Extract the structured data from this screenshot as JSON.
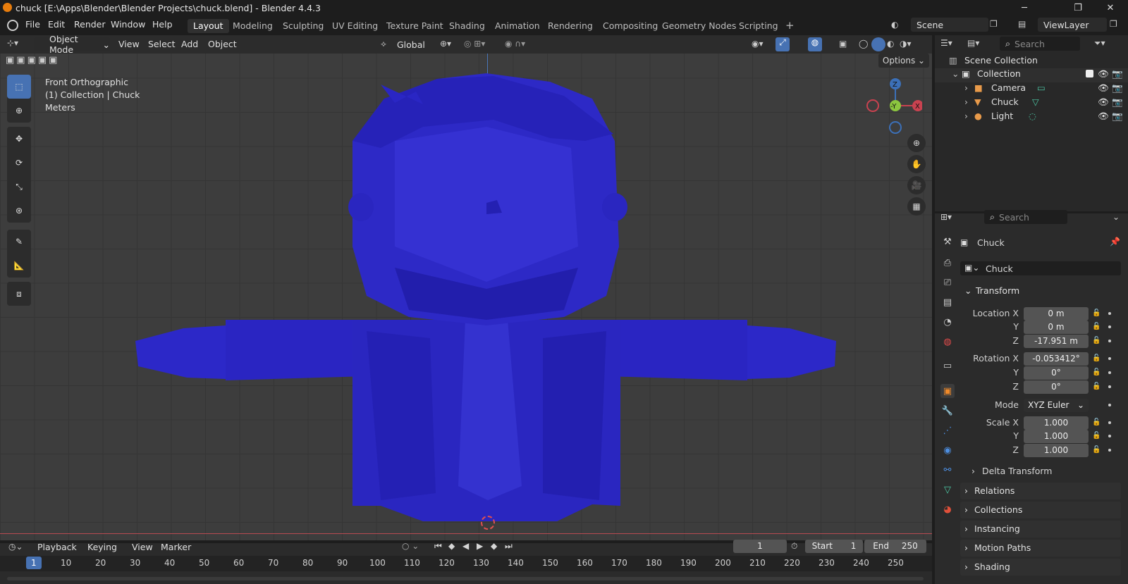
{
  "window": {
    "title": "chuck [E:\\Apps\\Blender\\Blender Projects\\chuck.blend] - Blender 4.4.3"
  },
  "menu": [
    "File",
    "Edit",
    "Render",
    "Window",
    "Help"
  ],
  "workspaces": [
    "Layout",
    "Modeling",
    "Sculpting",
    "UV Editing",
    "Texture Paint",
    "Shading",
    "Animation",
    "Rendering",
    "Compositing",
    "Geometry Nodes",
    "Scripting"
  ],
  "workspace_add": "+",
  "scene": "Scene",
  "viewlayer": "ViewLayer",
  "viewport": {
    "mode": "Object Mode",
    "menus": [
      "View",
      "Select",
      "Add",
      "Object"
    ],
    "orientation": "Global",
    "options": "Options",
    "view_name": "Front Orthographic",
    "collection_line": "(1) Collection | Chuck",
    "units": "Meters",
    "gizmo": {
      "z": "Z",
      "y": "-Y",
      "x": "X"
    }
  },
  "outliner": {
    "search_placeholder": "Search",
    "root": "Scene Collection",
    "collection": "Collection",
    "items": [
      {
        "name": "Camera"
      },
      {
        "name": "Chuck"
      },
      {
        "name": "Light"
      }
    ]
  },
  "properties": {
    "search_placeholder": "Search",
    "object_name": "Chuck",
    "data_name": "Chuck",
    "transform_label": "Transform",
    "location": {
      "label": "Location X",
      "x": "0 m",
      "y": "0 m",
      "z": "-17.951 m"
    },
    "rotation": {
      "label": "Rotation X",
      "x": "-0.053412°",
      "y": "0°",
      "z": "0°"
    },
    "mode_label": "Mode",
    "mode": "XYZ Euler",
    "scale": {
      "label": "Scale X",
      "x": "1.000",
      "y": "1.000",
      "z": "1.000"
    },
    "axis_y": "Y",
    "axis_z": "Z",
    "delta": "Delta Transform",
    "panels": [
      "Relations",
      "Collections",
      "Instancing",
      "Motion Paths",
      "Shading"
    ]
  },
  "timeline": {
    "menus": [
      "Playback",
      "Keying",
      "View",
      "Marker"
    ],
    "current_frame": "1",
    "start_label": "Start",
    "start": "1",
    "end_label": "End",
    "end": "250",
    "ruler": [
      "1",
      "10",
      "20",
      "30",
      "40",
      "50",
      "60",
      "70",
      "80",
      "90",
      "100",
      "110",
      "120",
      "130",
      "140",
      "150",
      "160",
      "170",
      "180",
      "190",
      "200",
      "210",
      "220",
      "230",
      "240",
      "250"
    ]
  },
  "colors": {
    "accent": "#4772b3",
    "mesh": "#2a27c4",
    "bg": "#3d3d3d"
  }
}
